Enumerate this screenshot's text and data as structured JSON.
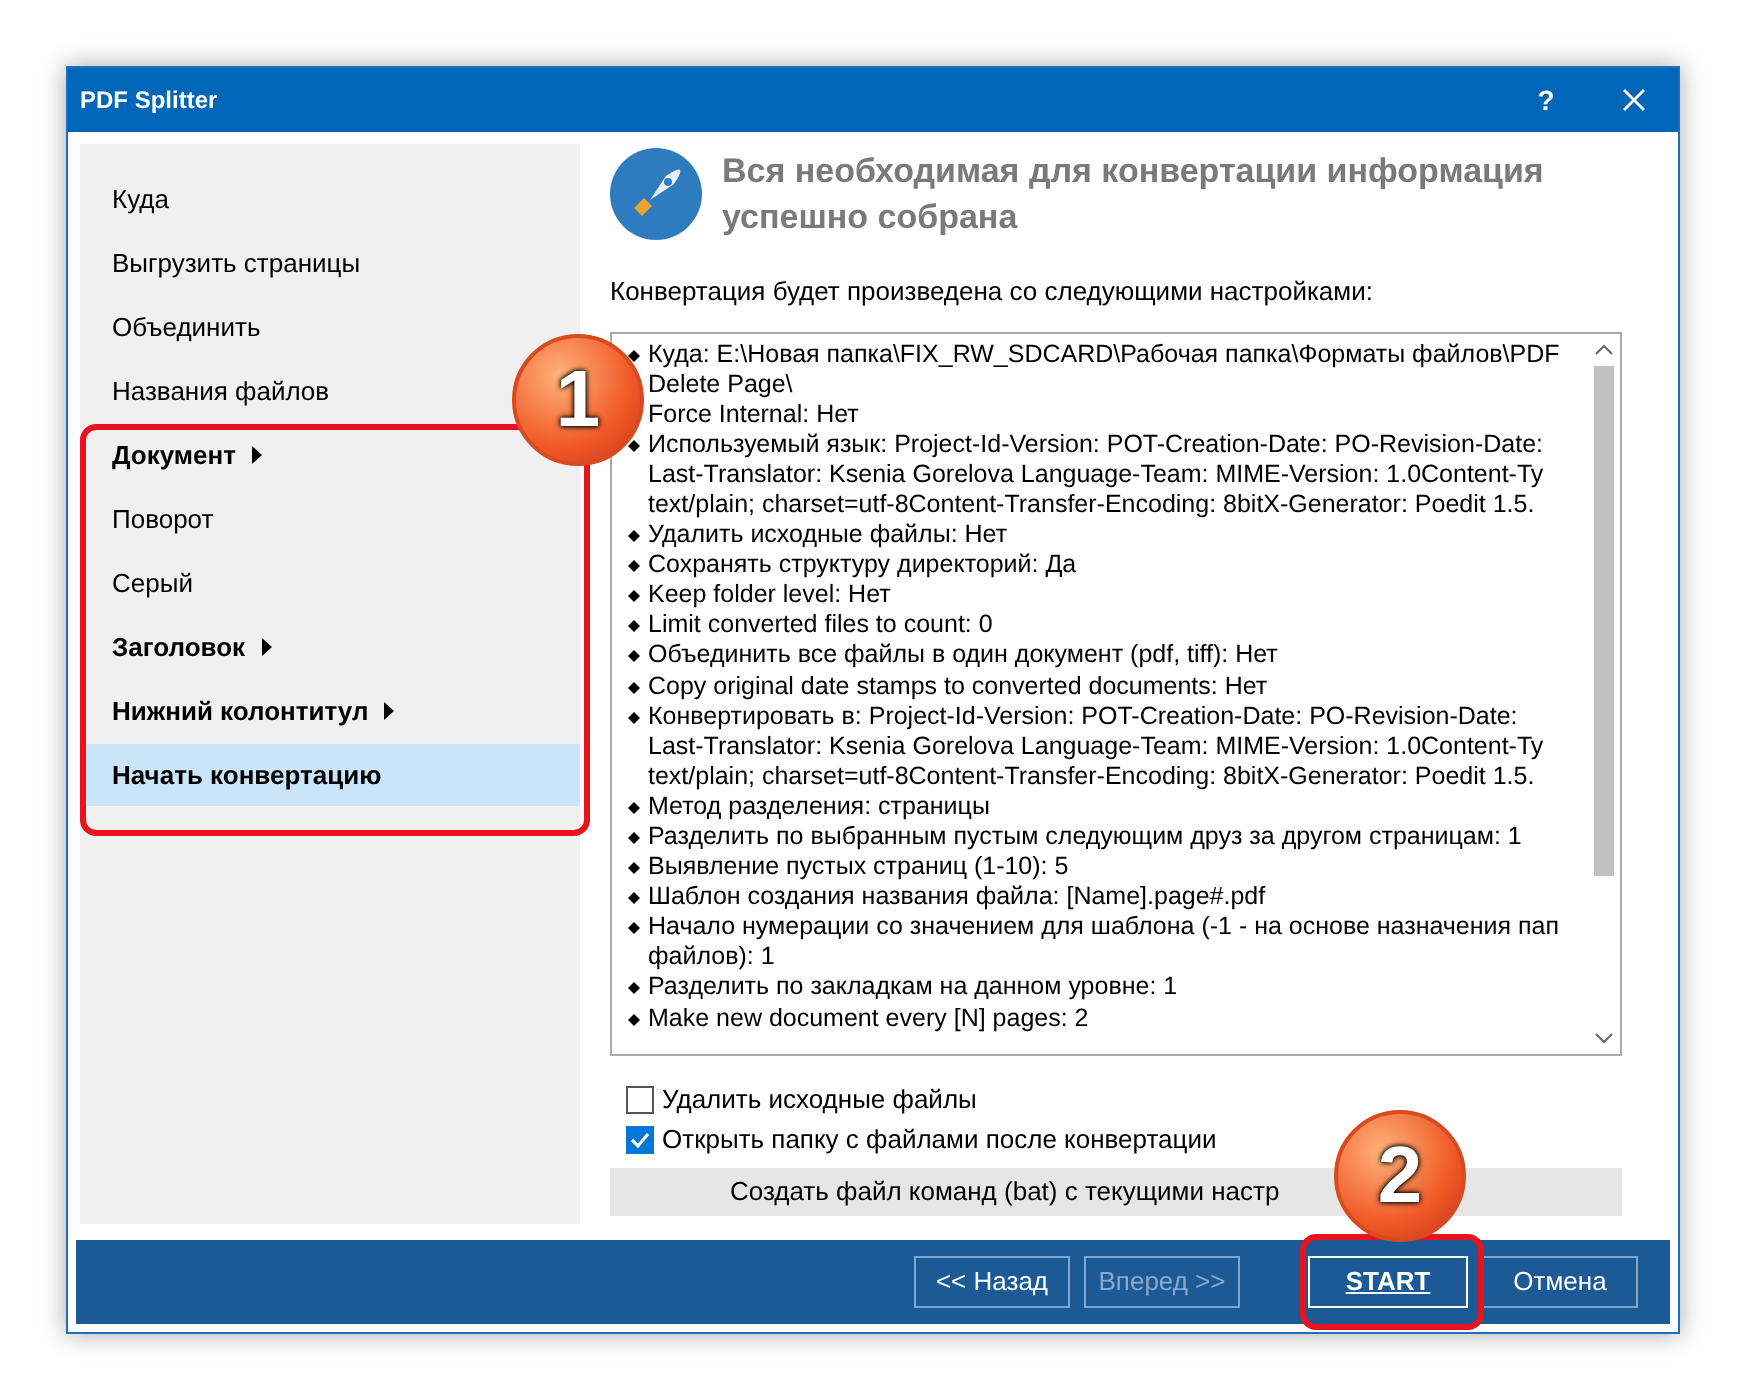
{
  "window": {
    "title": "PDF Splitter",
    "help_button": "?"
  },
  "sidebar": {
    "items": [
      {
        "label": "Куда",
        "kind": "page",
        "selected": false
      },
      {
        "label": "Выгрузить страницы",
        "kind": "page",
        "selected": false
      },
      {
        "label": "Объединить",
        "kind": "page",
        "selected": false
      },
      {
        "label": "Названия файлов",
        "kind": "page",
        "selected": false
      },
      {
        "label": "Документ",
        "kind": "group",
        "selected": false
      },
      {
        "label": "Поворот",
        "kind": "page",
        "selected": false
      },
      {
        "label": "Серый",
        "kind": "page",
        "selected": false
      },
      {
        "label": "Заголовок",
        "kind": "group",
        "selected": false
      },
      {
        "label": "Нижний колонтитул",
        "kind": "group",
        "selected": false
      },
      {
        "label": "Начать конвертацию",
        "kind": "group",
        "selected": true
      }
    ]
  },
  "header": {
    "title": "Вся необходимая для конвертации информация успешно собрана"
  },
  "intro": "Конвертация будет произведена со следующими настройками:",
  "settings": [
    [
      "Куда: E:\\Новая папка\\FIX_RW_SDCARD\\Рабочая папка\\Форматы файлов\\PDF",
      "Delete Page\\"
    ],
    [
      "Force Internal: Нет"
    ],
    [
      "Используемый язык: Project-Id-Version: POT-Creation-Date: PO-Revision-Date:",
      "Last-Translator: Ksenia Gorelova Language-Team: MIME-Version: 1.0Content-Ty",
      "text/plain; charset=utf-8Content-Transfer-Encoding: 8bitX-Generator: Poedit 1.5."
    ],
    [
      "Удалить исходные файлы: Нет"
    ],
    [
      "Сохранять структуру директорий: Да"
    ],
    [
      "Keep folder level: Нет"
    ],
    [
      "Limit converted files to count: 0"
    ],
    [
      "Объединить все файлы в один документ (pdf, tiff): Нет"
    ],
    [
      "Copy original date stamps to converted documents: Нет"
    ],
    [
      "Конвертировать в: Project-Id-Version: POT-Creation-Date: PO-Revision-Date:",
      "Last-Translator: Ksenia Gorelova Language-Team: MIME-Version: 1.0Content-Ty",
      "text/plain; charset=utf-8Content-Transfer-Encoding: 8bitX-Generator: Poedit 1.5."
    ],
    [
      "Метод разделения: страницы"
    ],
    [
      "Разделить по выбранным пустым следующим друз за другом страницам: 1"
    ],
    [
      "Выявление пустых страниц (1-10): 5"
    ],
    [
      "Шаблон создания названия файла: [Name].page#.pdf"
    ],
    [
      "Начало нумерации со значением для шаблона (-1 - на основе назначения пап",
      "файлов): 1"
    ],
    [
      "Разделить по закладкам на данном уровне: 1"
    ],
    [
      "Make new document every [N] pages: 2"
    ]
  ],
  "options": [
    {
      "label": "Удалить исходные файлы",
      "checked": false
    },
    {
      "label": "Открыть папку с файлами после конвертации",
      "checked": true
    }
  ],
  "bat_button": "Создать файл команд (bat) с текущими настр",
  "footer": {
    "buttons": [
      {
        "label": "<< Назад",
        "disabled": false,
        "default": false
      },
      {
        "label": "Вперед >>",
        "disabled": true,
        "default": false
      },
      {
        "label": "START",
        "disabled": false,
        "default": true
      },
      {
        "label": "Отмена",
        "disabled": false,
        "default": false
      }
    ]
  },
  "annotations": [
    {
      "label": "1"
    },
    {
      "label": "2"
    }
  ]
}
